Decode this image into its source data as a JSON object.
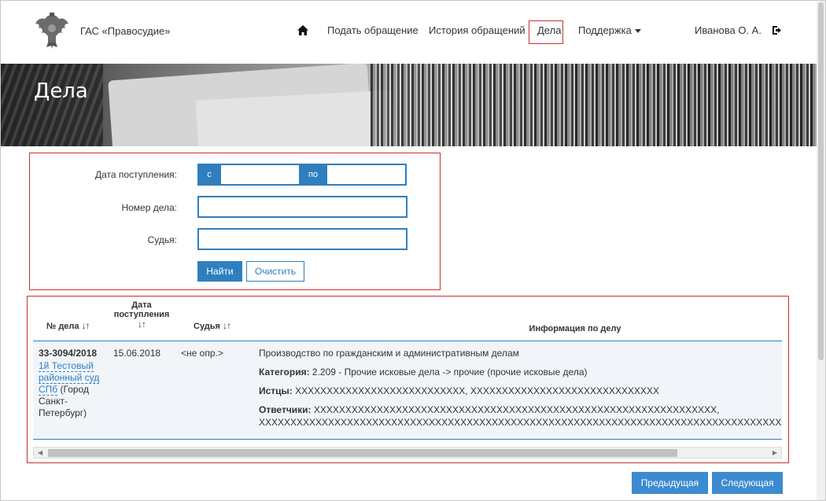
{
  "header": {
    "brand": "ГАС «Правосудие»",
    "nav": {
      "home_icon": "home-icon",
      "submit": "Подать обращение",
      "history": "История обращений",
      "cases": "Дела",
      "support": "Поддержка",
      "user": "Иванова О. А.",
      "logout_icon": "logout-icon"
    },
    "accent_color": "#c9302c"
  },
  "banner": {
    "title": "Дела"
  },
  "filter": {
    "date_label": "Дата поступления:",
    "from_addon": "с",
    "from_value": "",
    "to_addon": "по",
    "to_value": "",
    "case_number_label": "Номер дела:",
    "case_number_value": "",
    "judge_label": "Судья:",
    "judge_value": "",
    "find_button": "Найти",
    "clear_button": "Очистить"
  },
  "table": {
    "columns": {
      "number": "№ дела",
      "date": "Дата поступления",
      "judge": "Судья",
      "info": "Информация по делу"
    },
    "rows": [
      {
        "number": "33-3094/2018",
        "court_link": "1й Тестовый районный суд СПб",
        "court_city": "(Город Санкт-Петербург)",
        "date": "15.06.2018",
        "judge": "<не опр.>",
        "production": "Производство по гражданским и административным делам",
        "category_label": "Категория:",
        "category": "2.209 - Прочие исковые дела -> прочие (прочие исковые дела)",
        "plaintiffs_label": "Истцы:",
        "plaintiffs": "XXXXXXXXXXXXXXXXXXXXXXXXXXX, XXXXXXXXXXXXXXXXXXXXXXXXXXXXXX",
        "defendants_label": "Ответчики:",
        "defendants_1": "XXXXXXXXXXXXXXXXXXXXXXXXXXXXXXXXXXXXXXXXXXXXXXXXXXXXXXXXXXXXXXXX,",
        "defendants_2": "XXXXXXXXXXXXXXXXXXXXXXXXXXXXXXXXXXXXXXXXXXXXXXXXXXXXXXXXXXXXXXXXXXXXXXXXXXXXXXXXXXXXXXXXXXXXXXXXXXXXXXXXXX"
      }
    ]
  },
  "pagination": {
    "prev": "Предыдущая",
    "next": "Следующая"
  }
}
